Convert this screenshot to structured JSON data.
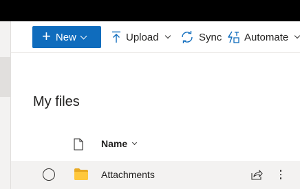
{
  "colors": {
    "brand": "#0f6cbd",
    "topbar": "#000000",
    "row_hover": "#f3f2f1"
  },
  "commandbar": {
    "new": {
      "label": "New",
      "icon": "plus-icon"
    },
    "upload": {
      "label": "Upload",
      "icon": "upload-icon"
    },
    "sync": {
      "label": "Sync",
      "icon": "sync-icon"
    },
    "automate": {
      "label": "Automate",
      "icon": "automate-icon"
    }
  },
  "main": {
    "title": "My files",
    "columns": {
      "file_type_icon": "document-icon",
      "name": "Name"
    },
    "files": [
      {
        "name": "Attachments",
        "type": "folder"
      }
    ]
  }
}
